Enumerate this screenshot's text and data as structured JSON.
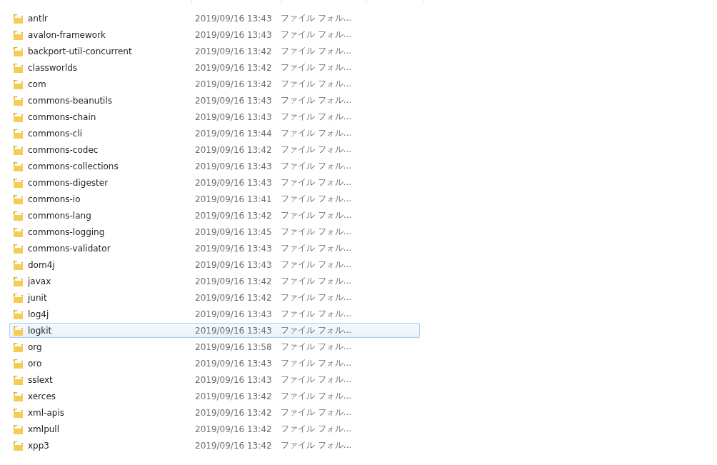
{
  "rows": [
    {
      "name": "antlr",
      "date": "2019/09/16 13:43",
      "type": "ファイル フォル...",
      "selected": false
    },
    {
      "name": "avalon-framework",
      "date": "2019/09/16 13:43",
      "type": "ファイル フォル...",
      "selected": false
    },
    {
      "name": "backport-util-concurrent",
      "date": "2019/09/16 13:42",
      "type": "ファイル フォル...",
      "selected": false
    },
    {
      "name": "classworlds",
      "date": "2019/09/16 13:42",
      "type": "ファイル フォル...",
      "selected": false
    },
    {
      "name": "com",
      "date": "2019/09/16 13:42",
      "type": "ファイル フォル...",
      "selected": false
    },
    {
      "name": "commons-beanutils",
      "date": "2019/09/16 13:43",
      "type": "ファイル フォル...",
      "selected": false
    },
    {
      "name": "commons-chain",
      "date": "2019/09/16 13:43",
      "type": "ファイル フォル...",
      "selected": false
    },
    {
      "name": "commons-cli",
      "date": "2019/09/16 13:44",
      "type": "ファイル フォル...",
      "selected": false
    },
    {
      "name": "commons-codec",
      "date": "2019/09/16 13:42",
      "type": "ファイル フォル...",
      "selected": false
    },
    {
      "name": "commons-collections",
      "date": "2019/09/16 13:43",
      "type": "ファイル フォル...",
      "selected": false
    },
    {
      "name": "commons-digester",
      "date": "2019/09/16 13:43",
      "type": "ファイル フォル...",
      "selected": false
    },
    {
      "name": "commons-io",
      "date": "2019/09/16 13:41",
      "type": "ファイル フォル...",
      "selected": false
    },
    {
      "name": "commons-lang",
      "date": "2019/09/16 13:42",
      "type": "ファイル フォル...",
      "selected": false
    },
    {
      "name": "commons-logging",
      "date": "2019/09/16 13:45",
      "type": "ファイル フォル...",
      "selected": false
    },
    {
      "name": "commons-validator",
      "date": "2019/09/16 13:43",
      "type": "ファイル フォル...",
      "selected": false
    },
    {
      "name": "dom4j",
      "date": "2019/09/16 13:43",
      "type": "ファイル フォル...",
      "selected": false
    },
    {
      "name": "javax",
      "date": "2019/09/16 13:42",
      "type": "ファイル フォル...",
      "selected": false
    },
    {
      "name": "junit",
      "date": "2019/09/16 13:42",
      "type": "ファイル フォル...",
      "selected": false
    },
    {
      "name": "log4j",
      "date": "2019/09/16 13:43",
      "type": "ファイル フォル...",
      "selected": false
    },
    {
      "name": "logkit",
      "date": "2019/09/16 13:43",
      "type": "ファイル フォル...",
      "selected": true
    },
    {
      "name": "org",
      "date": "2019/09/16 13:58",
      "type": "ファイル フォル...",
      "selected": false
    },
    {
      "name": "oro",
      "date": "2019/09/16 13:43",
      "type": "ファイル フォル...",
      "selected": false
    },
    {
      "name": "sslext",
      "date": "2019/09/16 13:43",
      "type": "ファイル フォル...",
      "selected": false
    },
    {
      "name": "xerces",
      "date": "2019/09/16 13:42",
      "type": "ファイル フォル...",
      "selected": false
    },
    {
      "name": "xml-apis",
      "date": "2019/09/16 13:42",
      "type": "ファイル フォル...",
      "selected": false
    },
    {
      "name": "xmlpull",
      "date": "2019/09/16 13:42",
      "type": "ファイル フォル...",
      "selected": false
    },
    {
      "name": "xpp3",
      "date": "2019/09/16 13:42",
      "type": "ファイル フォル...",
      "selected": false
    }
  ]
}
